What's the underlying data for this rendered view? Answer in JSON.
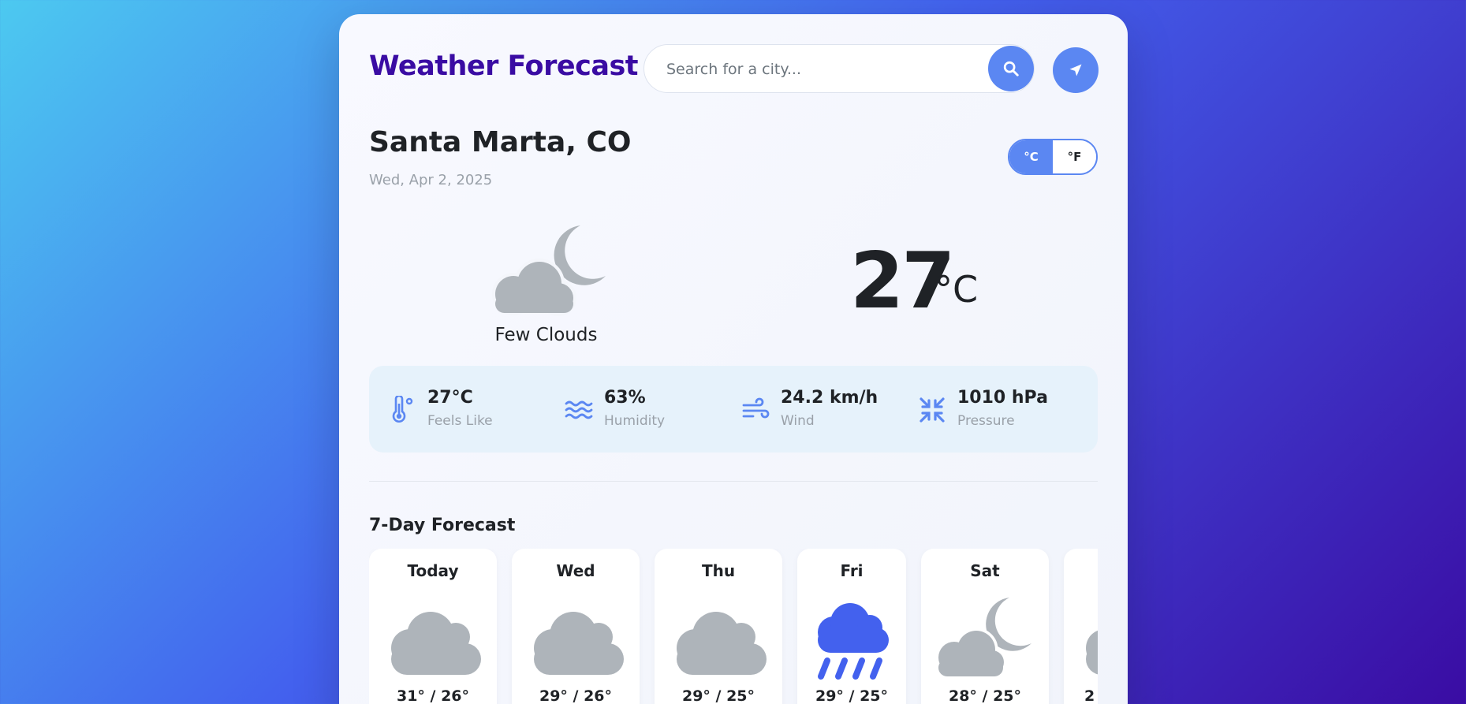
{
  "header": {
    "title": "Weather Forecast",
    "search_placeholder": "Search for a city...",
    "search_icon": "search-icon",
    "locate_icon": "location-arrow-icon"
  },
  "location": {
    "city": "Santa Marta, CO",
    "date": "Wed, Apr 2, 2025"
  },
  "units": {
    "celsius_label": "°C",
    "fahrenheit_label": "°F",
    "active": "celsius"
  },
  "current": {
    "icon": "cloud-moon-icon",
    "condition": "Few Clouds",
    "temp": "27",
    "unit": "°C"
  },
  "details": [
    {
      "icon": "thermometer-icon",
      "value": "27°C",
      "label": "Feels Like"
    },
    {
      "icon": "water-waves-icon",
      "value": "63%",
      "label": "Humidity"
    },
    {
      "icon": "wind-icon",
      "value": "24.2 km/h",
      "label": "Wind"
    },
    {
      "icon": "compress-icon",
      "value": "1010 hPa",
      "label": "Pressure"
    }
  ],
  "forecast": {
    "title": "7-Day Forecast",
    "days": [
      {
        "day": "Today",
        "icon": "cloud-icon",
        "temp": "31° / 26°"
      },
      {
        "day": "Wed",
        "icon": "cloud-icon",
        "temp": "29° / 26°"
      },
      {
        "day": "Thu",
        "icon": "cloud-icon",
        "temp": "29° / 25°"
      },
      {
        "day": "Fri",
        "icon": "cloud-rain-icon",
        "temp": "29° / 25°"
      },
      {
        "day": "Sat",
        "icon": "cloud-moon-icon",
        "temp": "28° / 25°"
      },
      {
        "day": "",
        "icon": "cloud-icon",
        "temp": "2"
      }
    ]
  },
  "colors": {
    "accent": "#5b87f2",
    "title": "#3a0ca3",
    "icon_gray": "#aeb4ba",
    "rain_blue": "#4361ee"
  }
}
